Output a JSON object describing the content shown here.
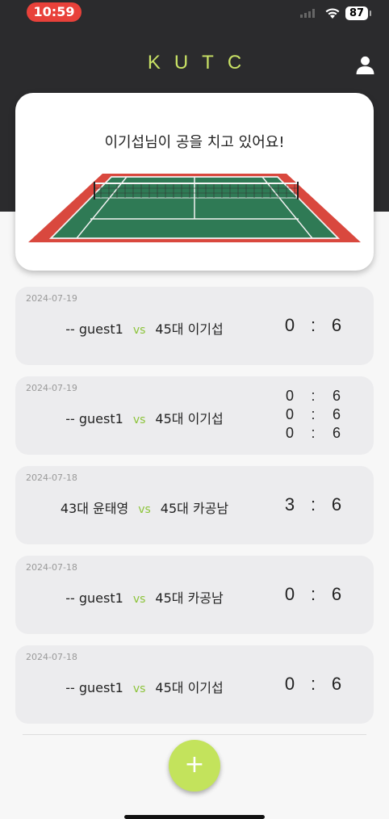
{
  "status_bar": {
    "time": "10:59",
    "battery": "87"
  },
  "header": {
    "title": "KUTC"
  },
  "hero": {
    "message": "이기섭님이 공을 치고 있어요!"
  },
  "matches": [
    {
      "date": "2024-07-19",
      "player1": "-- guest1",
      "vs": "vs",
      "player2": "45대 이기섭",
      "sets": [
        {
          "s1": "0",
          "sep": ":",
          "s2": "6"
        }
      ]
    },
    {
      "date": "2024-07-19",
      "player1": "-- guest1",
      "vs": "vs",
      "player2": "45대 이기섭",
      "sets": [
        {
          "s1": "0",
          "sep": ":",
          "s2": "6"
        },
        {
          "s1": "0",
          "sep": ":",
          "s2": "6"
        },
        {
          "s1": "0",
          "sep": ":",
          "s2": "6"
        }
      ]
    },
    {
      "date": "2024-07-18",
      "player1": "43대 윤태영",
      "vs": "vs",
      "player2": "45대 카공남",
      "sets": [
        {
          "s1": "3",
          "sep": ":",
          "s2": "6"
        }
      ]
    },
    {
      "date": "2024-07-18",
      "player1": "-- guest1",
      "vs": "vs",
      "player2": "45대 카공남",
      "sets": [
        {
          "s1": "0",
          "sep": ":",
          "s2": "6"
        }
      ]
    },
    {
      "date": "2024-07-18",
      "player1": "-- guest1",
      "vs": "vs",
      "player2": "45대 이기섭",
      "sets": [
        {
          "s1": "0",
          "sep": ":",
          "s2": "6"
        }
      ]
    }
  ],
  "fab": {
    "label": "+"
  },
  "colors": {
    "header_bg": "#2b2b2d",
    "accent": "#c3e35c",
    "vs": "#8cc43a",
    "court_green": "#2f7a55",
    "court_red": "#d9483e"
  }
}
